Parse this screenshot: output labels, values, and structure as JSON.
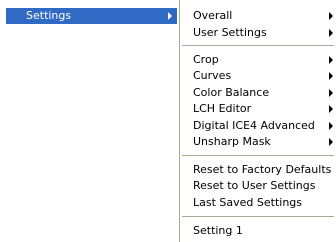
{
  "menu": {
    "selected_item": {
      "label": "Settings",
      "icon": "chevron-right-icon"
    }
  },
  "colors": {
    "highlight": "#316ac5",
    "highlight_text": "#ffffff",
    "separator": "#aca899"
  },
  "submenu": {
    "group1": [
      {
        "label": "Overall",
        "icon": "chevron-right-icon"
      },
      {
        "label": "User Settings",
        "icon": "chevron-right-icon"
      }
    ],
    "group2": [
      {
        "label": "Crop",
        "icon": "chevron-right-icon"
      },
      {
        "label": "Curves",
        "icon": "chevron-right-icon"
      },
      {
        "label": "Color Balance",
        "icon": "chevron-right-icon"
      },
      {
        "label": "LCH Editor",
        "icon": "chevron-right-icon"
      },
      {
        "label": "Digital ICE4 Advanced",
        "icon": "chevron-right-icon"
      },
      {
        "label": "Unsharp Mask",
        "icon": "chevron-right-icon"
      }
    ],
    "group3": [
      {
        "label": "Reset to Factory Defaults"
      },
      {
        "label": "Reset to User Settings"
      },
      {
        "label": "Last Saved Settings"
      }
    ],
    "group4": [
      {
        "label": "Setting 1"
      }
    ]
  }
}
